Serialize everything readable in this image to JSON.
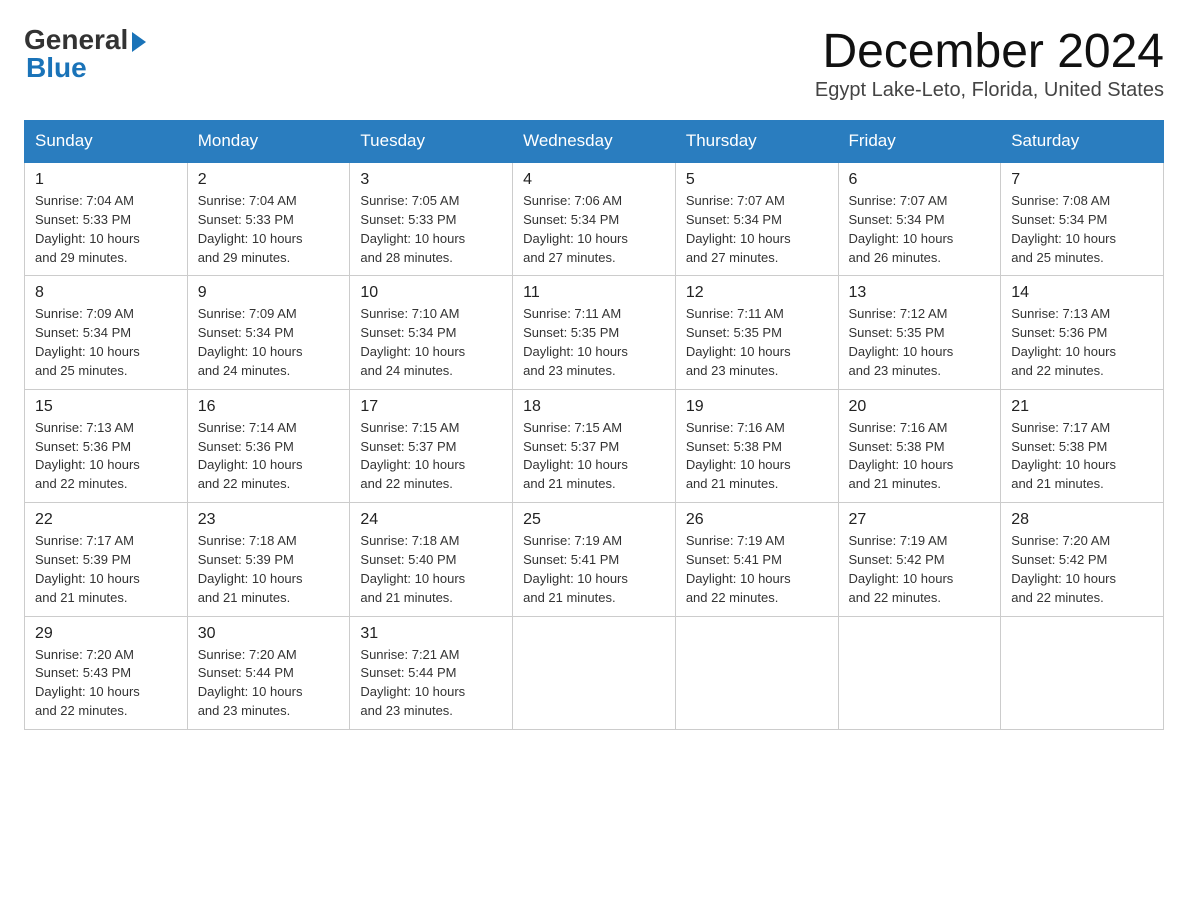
{
  "logo": {
    "general": "General",
    "blue": "Blue"
  },
  "title": "December 2024",
  "location": "Egypt Lake-Leto, Florida, United States",
  "days_of_week": [
    "Sunday",
    "Monday",
    "Tuesday",
    "Wednesday",
    "Thursday",
    "Friday",
    "Saturday"
  ],
  "weeks": [
    [
      {
        "day": "1",
        "sunrise": "7:04 AM",
        "sunset": "5:33 PM",
        "daylight": "10 hours and 29 minutes."
      },
      {
        "day": "2",
        "sunrise": "7:04 AM",
        "sunset": "5:33 PM",
        "daylight": "10 hours and 29 minutes."
      },
      {
        "day": "3",
        "sunrise": "7:05 AM",
        "sunset": "5:33 PM",
        "daylight": "10 hours and 28 minutes."
      },
      {
        "day": "4",
        "sunrise": "7:06 AM",
        "sunset": "5:34 PM",
        "daylight": "10 hours and 27 minutes."
      },
      {
        "day": "5",
        "sunrise": "7:07 AM",
        "sunset": "5:34 PM",
        "daylight": "10 hours and 27 minutes."
      },
      {
        "day": "6",
        "sunrise": "7:07 AM",
        "sunset": "5:34 PM",
        "daylight": "10 hours and 26 minutes."
      },
      {
        "day": "7",
        "sunrise": "7:08 AM",
        "sunset": "5:34 PM",
        "daylight": "10 hours and 25 minutes."
      }
    ],
    [
      {
        "day": "8",
        "sunrise": "7:09 AM",
        "sunset": "5:34 PM",
        "daylight": "10 hours and 25 minutes."
      },
      {
        "day": "9",
        "sunrise": "7:09 AM",
        "sunset": "5:34 PM",
        "daylight": "10 hours and 24 minutes."
      },
      {
        "day": "10",
        "sunrise": "7:10 AM",
        "sunset": "5:34 PM",
        "daylight": "10 hours and 24 minutes."
      },
      {
        "day": "11",
        "sunrise": "7:11 AM",
        "sunset": "5:35 PM",
        "daylight": "10 hours and 23 minutes."
      },
      {
        "day": "12",
        "sunrise": "7:11 AM",
        "sunset": "5:35 PM",
        "daylight": "10 hours and 23 minutes."
      },
      {
        "day": "13",
        "sunrise": "7:12 AM",
        "sunset": "5:35 PM",
        "daylight": "10 hours and 23 minutes."
      },
      {
        "day": "14",
        "sunrise": "7:13 AM",
        "sunset": "5:36 PM",
        "daylight": "10 hours and 22 minutes."
      }
    ],
    [
      {
        "day": "15",
        "sunrise": "7:13 AM",
        "sunset": "5:36 PM",
        "daylight": "10 hours and 22 minutes."
      },
      {
        "day": "16",
        "sunrise": "7:14 AM",
        "sunset": "5:36 PM",
        "daylight": "10 hours and 22 minutes."
      },
      {
        "day": "17",
        "sunrise": "7:15 AM",
        "sunset": "5:37 PM",
        "daylight": "10 hours and 22 minutes."
      },
      {
        "day": "18",
        "sunrise": "7:15 AM",
        "sunset": "5:37 PM",
        "daylight": "10 hours and 21 minutes."
      },
      {
        "day": "19",
        "sunrise": "7:16 AM",
        "sunset": "5:38 PM",
        "daylight": "10 hours and 21 minutes."
      },
      {
        "day": "20",
        "sunrise": "7:16 AM",
        "sunset": "5:38 PM",
        "daylight": "10 hours and 21 minutes."
      },
      {
        "day": "21",
        "sunrise": "7:17 AM",
        "sunset": "5:38 PM",
        "daylight": "10 hours and 21 minutes."
      }
    ],
    [
      {
        "day": "22",
        "sunrise": "7:17 AM",
        "sunset": "5:39 PM",
        "daylight": "10 hours and 21 minutes."
      },
      {
        "day": "23",
        "sunrise": "7:18 AM",
        "sunset": "5:39 PM",
        "daylight": "10 hours and 21 minutes."
      },
      {
        "day": "24",
        "sunrise": "7:18 AM",
        "sunset": "5:40 PM",
        "daylight": "10 hours and 21 minutes."
      },
      {
        "day": "25",
        "sunrise": "7:19 AM",
        "sunset": "5:41 PM",
        "daylight": "10 hours and 21 minutes."
      },
      {
        "day": "26",
        "sunrise": "7:19 AM",
        "sunset": "5:41 PM",
        "daylight": "10 hours and 22 minutes."
      },
      {
        "day": "27",
        "sunrise": "7:19 AM",
        "sunset": "5:42 PM",
        "daylight": "10 hours and 22 minutes."
      },
      {
        "day": "28",
        "sunrise": "7:20 AM",
        "sunset": "5:42 PM",
        "daylight": "10 hours and 22 minutes."
      }
    ],
    [
      {
        "day": "29",
        "sunrise": "7:20 AM",
        "sunset": "5:43 PM",
        "daylight": "10 hours and 22 minutes."
      },
      {
        "day": "30",
        "sunrise": "7:20 AM",
        "sunset": "5:44 PM",
        "daylight": "10 hours and 23 minutes."
      },
      {
        "day": "31",
        "sunrise": "7:21 AM",
        "sunset": "5:44 PM",
        "daylight": "10 hours and 23 minutes."
      },
      null,
      null,
      null,
      null
    ]
  ],
  "labels": {
    "sunrise": "Sunrise:",
    "sunset": "Sunset:",
    "daylight": "Daylight:"
  }
}
